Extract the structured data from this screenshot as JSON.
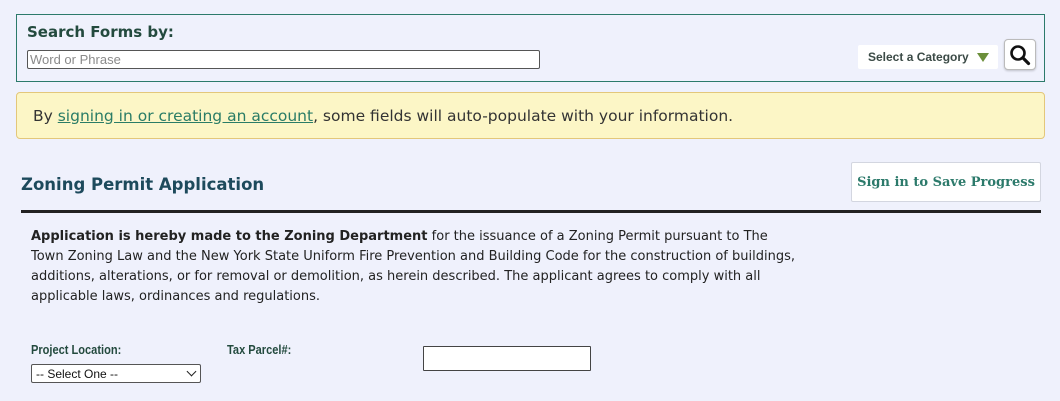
{
  "search": {
    "title": "Search Forms by:",
    "placeholder": "Word or Phrase",
    "category_label": "Select a Category"
  },
  "notice": {
    "prefix": "By ",
    "link": "signing in or creating an account",
    "suffix": ", some fields will auto-populate with your information."
  },
  "form": {
    "title": "Zoning Permit Application",
    "save_button": "Sign in to Save Progress",
    "intro_bold": "Application is hereby made to the Zoning Department",
    "intro_rest": " for the issuance of a Zoning Permit pursuant to The Town Zoning Law and the New York State Uniform Fire Prevention and Building Code for the construction of buildings, additions, alterations, or for removal or demolition, as herein described.  The applicant agrees to comply with all applicable laws, ordinances and regulations.",
    "fields": {
      "project_location_label": "Project Location:",
      "project_location_value": "-- Select One --",
      "tax_parcel_label": "Tax Parcel#:",
      "tax_parcel_value": ""
    }
  },
  "colors": {
    "accent": "#2c7a6b",
    "title": "#1d4a5c",
    "notice_bg": "#fcf6c6",
    "page_bg": "#eff1fc"
  },
  "icons": {
    "search_button": "magnifier-icon",
    "category_dropdown": "triangle-down-icon",
    "select_dropdown": "chevron-down-icon"
  }
}
